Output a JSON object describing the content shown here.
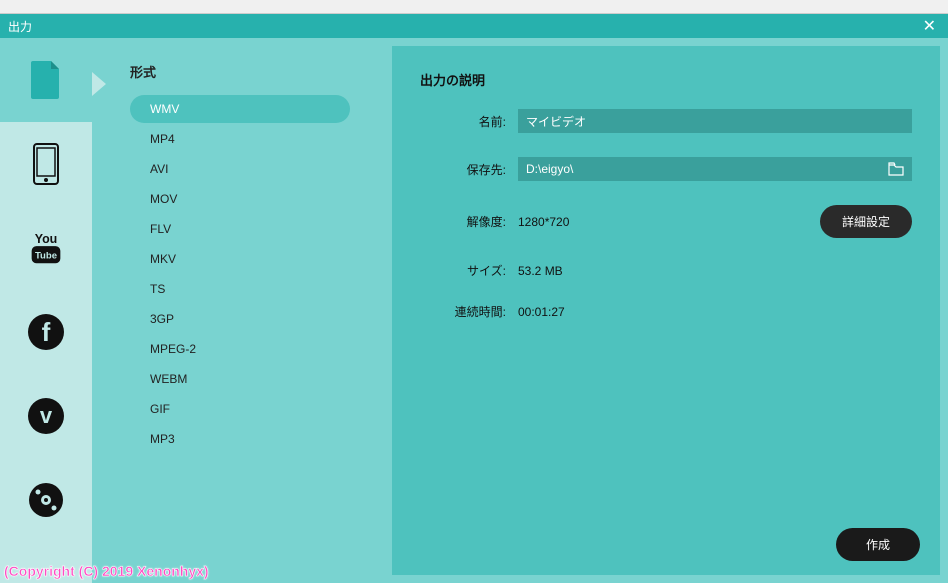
{
  "header": {
    "title": "出力"
  },
  "categories": [
    {
      "name": "file",
      "active": true
    },
    {
      "name": "mobile",
      "active": false
    },
    {
      "name": "youtube",
      "active": false
    },
    {
      "name": "facebook",
      "active": false
    },
    {
      "name": "vimeo",
      "active": false
    },
    {
      "name": "dvd",
      "active": false
    }
  ],
  "format": {
    "title": "形式",
    "items": [
      "WMV",
      "MP4",
      "AVI",
      "MOV",
      "FLV",
      "MKV",
      "TS",
      "3GP",
      "MPEG-2",
      "WEBM",
      "GIF",
      "MP3"
    ],
    "selected": "WMV"
  },
  "details": {
    "title": "出力の説明",
    "name_label": "名前:",
    "name_value": "マイビデオ",
    "save_label": "保存先:",
    "save_path": "D:\\eigyo\\",
    "resolution_label": "解像度:",
    "resolution_value": "1280*720",
    "size_label": "サイズ:",
    "size_value": "53.2 MB",
    "duration_label": "連続時間:",
    "duration_value": "00:01:27",
    "detail_btn": "詳細設定",
    "create_btn": "作成"
  },
  "watermark": "(Copyright (C) 2019 Xenonhyx)"
}
